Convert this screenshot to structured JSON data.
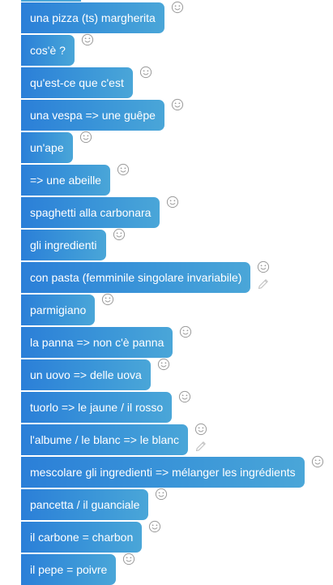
{
  "messages": [
    {
      "text": "una pizza (ts) margherita"
    },
    {
      "text": "cos'è ?"
    },
    {
      "text": "qu'est-ce que c'est"
    },
    {
      "text": "una vespa => une guêpe"
    },
    {
      "text": "un'ape"
    },
    {
      "text": "=> une abeille"
    },
    {
      "text": "spaghetti alla carbonara"
    },
    {
      "text": "gli ingredienti"
    },
    {
      "text": "con pasta (femminile singolare invariabile)",
      "edit_icon": "pencil-icon"
    },
    {
      "text": "parmigiano"
    },
    {
      "text": "la panna => non c'è panna"
    },
    {
      "text": "un uovo => delle uova"
    },
    {
      "text": "tuorlo => le jaune / il rosso"
    },
    {
      "text": "l'albume / le blanc => le blanc",
      "edit_icon": "pencil-icon"
    },
    {
      "text": "mescolare gli ingredienti => mélanger les ingrédients"
    },
    {
      "text": "pancetta / il guanciale"
    },
    {
      "text": "il carbone = charbon"
    },
    {
      "text": "il pepe = poivre"
    }
  ],
  "react_icon": "smiley-icon",
  "colors": {
    "bubble_start": "#2b7fd8",
    "bubble_end": "#4aa6d8",
    "text": "#ffffff",
    "icon": "#9a9a9a",
    "pencil": "#c2c2c2"
  }
}
